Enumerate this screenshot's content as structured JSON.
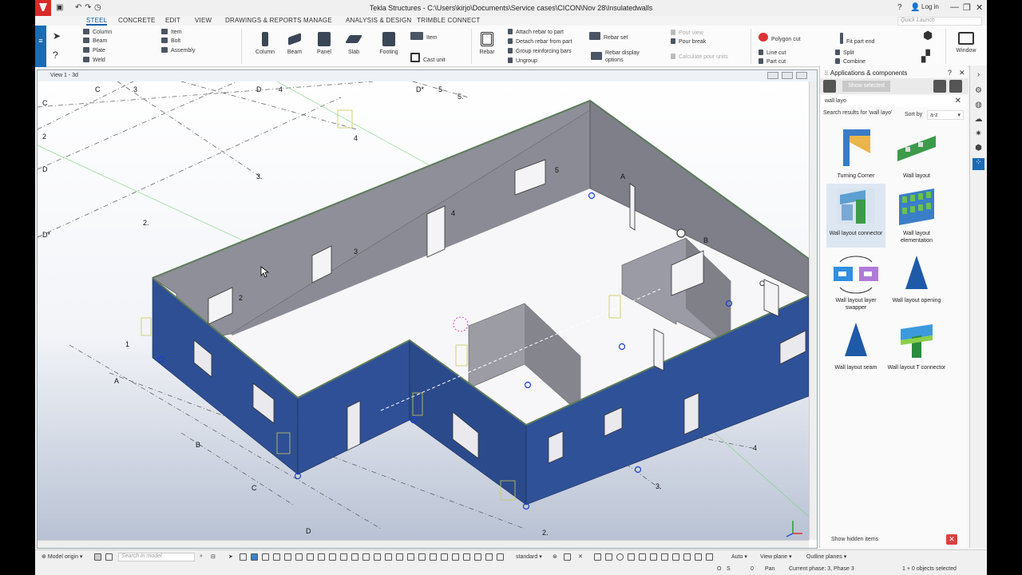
{
  "window": {
    "title": "Tekla Structures - C:\\Users\\kirjo\\Documents\\Service cases\\CICON\\Nov 28\\Insulatedwalls",
    "login": "Log in"
  },
  "menu": [
    "STEEL",
    "CONCRETE",
    "EDIT",
    "VIEW",
    "DRAWINGS & REPORTS",
    "MANAGE",
    "ANALYSIS & DESIGN",
    "TRIMBLE CONNECT"
  ],
  "quick_launch_placeholder": "Quick Launch",
  "ribbon": {
    "steel_items": [
      "Column",
      "Beam",
      "Plate",
      "Weld"
    ],
    "misc_items": [
      "Item",
      "Bolt",
      "Assembly"
    ],
    "big_buttons": [
      "Column",
      "Beam",
      "Panel",
      "Slab",
      "Footing"
    ],
    "item": "Item",
    "cast_unit": "Cast unit",
    "rebar": "Rebar",
    "rebar_actions": [
      "Attach rebar to part",
      "Detach rebar from part",
      "Group reinforcing bars",
      "Ungroup"
    ],
    "rebar_set": "Rebar set",
    "rebar_display_options": "Rebar display options",
    "pour_view": "Pour view",
    "pour_break": "Pour break",
    "calculate_pour_units": "Calculate pour units",
    "polygon_cut": "Polygon cut",
    "line_cut": "Line cut",
    "part_cut": "Part cut",
    "fit_part_end": "Fit part end",
    "split": "Split",
    "combine": "Combine",
    "window": "Window"
  },
  "view": {
    "title": "View 1 - 3d"
  },
  "grid_labels": [
    "C",
    "3",
    "D",
    "4",
    "D*",
    "5",
    "5.",
    "C",
    "2",
    "D",
    "3.",
    "2.",
    "D*",
    "4",
    "5",
    "4",
    "3",
    "2",
    "A",
    "B",
    "C",
    "1",
    "A",
    "B",
    "C",
    "D",
    "2.",
    "3.",
    "4"
  ],
  "panel": {
    "title": "Applications & components",
    "show_selected": "Show selected",
    "search_value": "wall layo",
    "results_text": "Search results for 'wall layo'",
    "sort_by_label": "Sort by",
    "sort_value": "a-z",
    "components": [
      {
        "name": "Turning Corner"
      },
      {
        "name": "Wall layout"
      },
      {
        "name": "Wall layout connector"
      },
      {
        "name": "Wall layout elementation"
      },
      {
        "name": "Wall layout layer swapper"
      },
      {
        "name": "Wall layout opening"
      },
      {
        "name": "Wall layout seam"
      },
      {
        "name": "Wall layout T connector"
      }
    ],
    "show_hidden_items": "Show hidden items"
  },
  "bottom": {
    "model_origin": "Model origin",
    "search_placeholder": "Search in model",
    "standard": "standard",
    "auto": "Auto",
    "view_plane": "View plane",
    "outline_planes": "Outline planes"
  },
  "status": {
    "o": "O",
    "s": "S",
    "zero": "0",
    "pan": "Pan",
    "phase": "Current phase: 3, Phase 3",
    "selected": "1 + 0 objects selected"
  },
  "colors": {
    "wall_blue": "#2e4f93",
    "wall_grey": "#8e8f98",
    "accent": "#1a6bb5"
  }
}
